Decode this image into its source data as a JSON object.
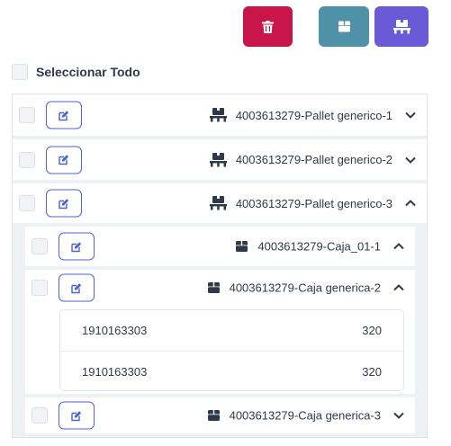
{
  "toolbar": {
    "delete_icon": "trash-icon",
    "box_icon": "box-icon",
    "pallet_icon": "pallet-icon",
    "colors": {
      "delete": "#c8154a",
      "box": "#4f91a6",
      "pallet": "#6a5ad8"
    }
  },
  "select_all": {
    "label": "Seleccionar Todo"
  },
  "pallets": [
    {
      "label": "4003613279-Pallet generico-1",
      "expanded": false
    },
    {
      "label": "4003613279-Pallet generico-2",
      "expanded": false
    },
    {
      "label": "4003613279-Pallet generico-3",
      "expanded": true
    }
  ],
  "boxes": [
    {
      "label": "4003613279-Caja_01-1",
      "expanded": true
    },
    {
      "label": "4003613279-Caja generica-2",
      "expanded": true
    },
    {
      "label": "4003613279-Caja generica-3",
      "expanded": false
    }
  ],
  "box_items": [
    {
      "code": "1910163303",
      "qty": "320"
    },
    {
      "code": "1910163303",
      "qty": "320"
    }
  ]
}
